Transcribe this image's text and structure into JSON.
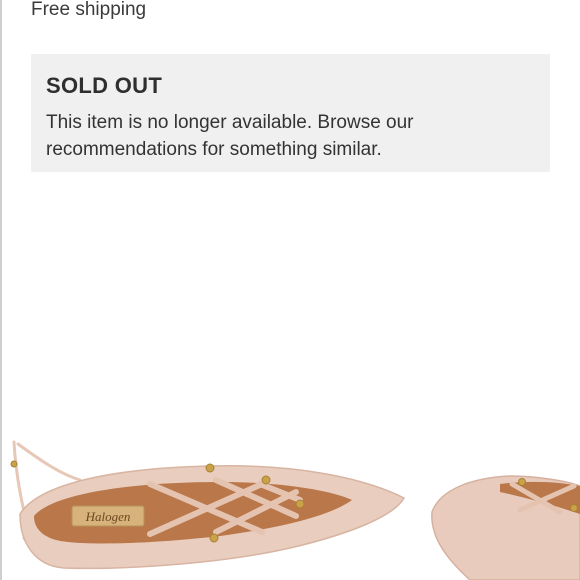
{
  "shipping": {
    "label": "Free shipping"
  },
  "availability": {
    "status": "SOLD OUT",
    "message": "This item is no longer available. Browse our recommendations for something similar."
  },
  "product_image": {
    "brand_logo_text": "Halogen",
    "alt": ""
  },
  "colors": {
    "panel_background": "#f0f0f0",
    "shoe_blush": "#e9cdbf",
    "lining_tan": "#b9774a",
    "hardware_gold": "#c9a24a"
  }
}
